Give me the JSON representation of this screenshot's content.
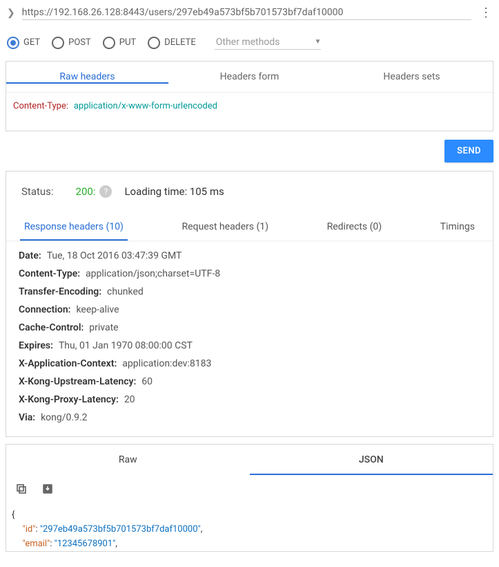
{
  "url": "https://192.168.26.128:8443/users/297eb49a573bf5b701573bf7daf10000",
  "methods": {
    "get": "GET",
    "post": "POST",
    "put": "PUT",
    "delete": "DELETE",
    "other": "Other methods"
  },
  "header_tabs": {
    "raw": "Raw headers",
    "form": "Headers form",
    "sets": "Headers sets"
  },
  "raw_header": {
    "key": "Content-Type:",
    "value": "application/x-www-form-urlencoded"
  },
  "send": "SEND",
  "status": {
    "label": "Status:",
    "code": "200:",
    "loading": "Loading time: 105 ms"
  },
  "resp_tabs": {
    "resp_h": "Response headers (10)",
    "req_h": "Request headers (1)",
    "redir": "Redirects (0)",
    "timings": "Timings"
  },
  "response_headers": [
    {
      "k": "Date:",
      "v": "Tue, 18 Oct 2016 03:47:39 GMT"
    },
    {
      "k": "Content-Type:",
      "v": "application/json;charset=UTF-8"
    },
    {
      "k": "Transfer-Encoding:",
      "v": "chunked"
    },
    {
      "k": "Connection:",
      "v": "keep-alive"
    },
    {
      "k": "Cache-Control:",
      "v": "private"
    },
    {
      "k": "Expires:",
      "v": "Thu, 01 Jan 1970 08:00:00 CST"
    },
    {
      "k": "X-Application-Context:",
      "v": "application:dev:8183"
    },
    {
      "k": "X-Kong-Upstream-Latency:",
      "v": "60"
    },
    {
      "k": "X-Kong-Proxy-Latency:",
      "v": "20"
    },
    {
      "k": "Via:",
      "v": "kong/0.9.2"
    }
  ],
  "body_tabs": {
    "raw": "Raw",
    "json": "JSON"
  },
  "json_preview": {
    "k1": "\"id\"",
    "v1": "\"297eb49a573bf5b701573bf7daf10000\"",
    "k2": "\"email\"",
    "v2": "\"12345678901\""
  }
}
